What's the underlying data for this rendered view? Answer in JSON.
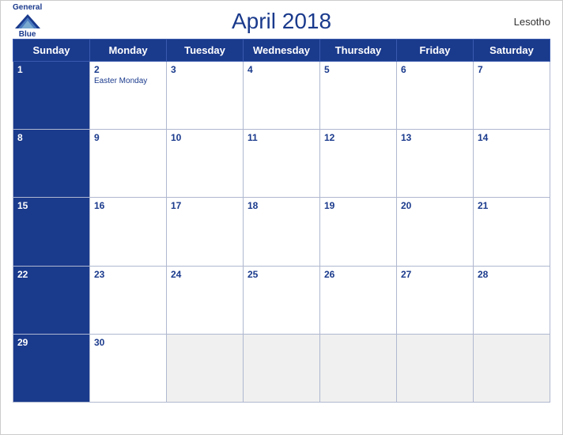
{
  "header": {
    "title": "April 2018",
    "country": "Lesotho",
    "logo_general": "General",
    "logo_blue": "Blue"
  },
  "days": [
    "Sunday",
    "Monday",
    "Tuesday",
    "Wednesday",
    "Thursday",
    "Friday",
    "Saturday"
  ],
  "weeks": [
    [
      {
        "date": "1",
        "holiday": "",
        "row_header": true
      },
      {
        "date": "2",
        "holiday": "Easter Monday",
        "row_header": true
      },
      {
        "date": "3",
        "holiday": "",
        "row_header": true
      },
      {
        "date": "4",
        "holiday": "",
        "row_header": true
      },
      {
        "date": "5",
        "holiday": "",
        "row_header": true
      },
      {
        "date": "6",
        "holiday": "",
        "row_header": true
      },
      {
        "date": "7",
        "holiday": "",
        "row_header": true
      }
    ],
    [
      {
        "date": "8",
        "holiday": "",
        "row_header": true
      },
      {
        "date": "9",
        "holiday": "",
        "row_header": true
      },
      {
        "date": "10",
        "holiday": "",
        "row_header": true
      },
      {
        "date": "11",
        "holiday": "",
        "row_header": true
      },
      {
        "date": "12",
        "holiday": "",
        "row_header": true
      },
      {
        "date": "13",
        "holiday": "",
        "row_header": true
      },
      {
        "date": "14",
        "holiday": "",
        "row_header": true
      }
    ],
    [
      {
        "date": "15",
        "holiday": "",
        "row_header": true
      },
      {
        "date": "16",
        "holiday": "",
        "row_header": true
      },
      {
        "date": "17",
        "holiday": "",
        "row_header": true
      },
      {
        "date": "18",
        "holiday": "",
        "row_header": true
      },
      {
        "date": "19",
        "holiday": "",
        "row_header": true
      },
      {
        "date": "20",
        "holiday": "",
        "row_header": true
      },
      {
        "date": "21",
        "holiday": "",
        "row_header": true
      }
    ],
    [
      {
        "date": "22",
        "holiday": "",
        "row_header": true
      },
      {
        "date": "23",
        "holiday": "",
        "row_header": true
      },
      {
        "date": "24",
        "holiday": "",
        "row_header": true
      },
      {
        "date": "25",
        "holiday": "",
        "row_header": true
      },
      {
        "date": "26",
        "holiday": "",
        "row_header": true
      },
      {
        "date": "27",
        "holiday": "",
        "row_header": true
      },
      {
        "date": "28",
        "holiday": "",
        "row_header": true
      }
    ],
    [
      {
        "date": "29",
        "holiday": "",
        "row_header": true
      },
      {
        "date": "30",
        "holiday": "",
        "row_header": true
      },
      {
        "date": "",
        "holiday": "",
        "row_header": false,
        "empty": true
      },
      {
        "date": "",
        "holiday": "",
        "row_header": false,
        "empty": true
      },
      {
        "date": "",
        "holiday": "",
        "row_header": false,
        "empty": true
      },
      {
        "date": "",
        "holiday": "",
        "row_header": false,
        "empty": true
      },
      {
        "date": "",
        "holiday": "",
        "row_header": false,
        "empty": true
      }
    ]
  ]
}
